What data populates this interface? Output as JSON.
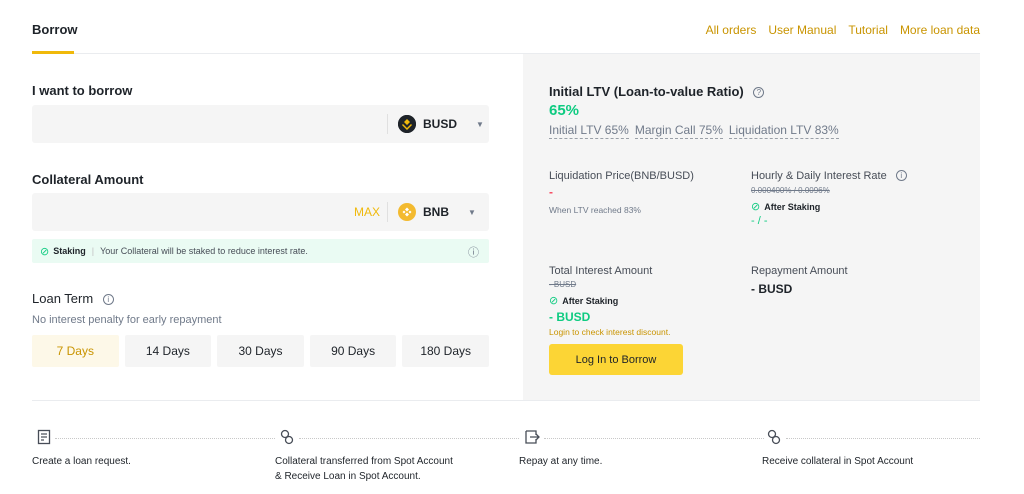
{
  "header": {
    "tab": "Borrow",
    "links": [
      "All orders",
      "User Manual",
      "Tutorial",
      "More loan data"
    ]
  },
  "borrow": {
    "label": "I want to borrow",
    "value": "",
    "coin": "BUSD"
  },
  "collateral": {
    "label": "Collateral Amount",
    "value": "",
    "max": "MAX",
    "coin": "BNB"
  },
  "staking": {
    "title": "Staking",
    "text": "Your Collateral will be staked to reduce interest rate."
  },
  "loan_term": {
    "label": "Loan Term",
    "note": "No interest penalty for early repayment",
    "options": [
      "7 Days",
      "14 Days",
      "30 Days",
      "90 Days",
      "180 Days"
    ],
    "selected": "7 Days"
  },
  "panel": {
    "ltv_title": "Initial LTV (Loan-to-value Ratio)",
    "ltv_value": "65%",
    "ltv_initial": "Initial LTV 65%",
    "ltv_margin": "Margin Call 75%",
    "ltv_liquidation": "Liquidation LTV 83%",
    "liq_price_label": "Liquidation Price(BNB/BUSD)",
    "liq_price_value": "-",
    "liq_note": "When LTV reached 83%",
    "rate_label": "Hourly & Daily Interest Rate",
    "rate_old": "0.000400% / 0.0096%",
    "after_staking": "After Staking",
    "rate_after": "- / -",
    "total_interest_label": "Total Interest Amount",
    "total_interest_old": "- BUSD",
    "total_interest_after": "- BUSD",
    "login_note": "Login to check interest discount.",
    "repayment_label": "Repayment Amount",
    "repayment_value": "- BUSD",
    "login_button": "Log In to Borrow"
  },
  "steps": [
    {
      "icon": "document-icon",
      "text": "Create a loan request."
    },
    {
      "icon": "exchange-icon",
      "text": "Collateral transferred from Spot Account & Receive Loan in Spot Account."
    },
    {
      "icon": "repay-icon",
      "text": "Repay at any time."
    },
    {
      "icon": "exchange-icon",
      "text": "Receive collateral in Spot Account"
    }
  ],
  "colors": {
    "accent": "#f0b90b",
    "button": "#fcd535",
    "green": "#0ecb81",
    "red": "#f6465d"
  }
}
